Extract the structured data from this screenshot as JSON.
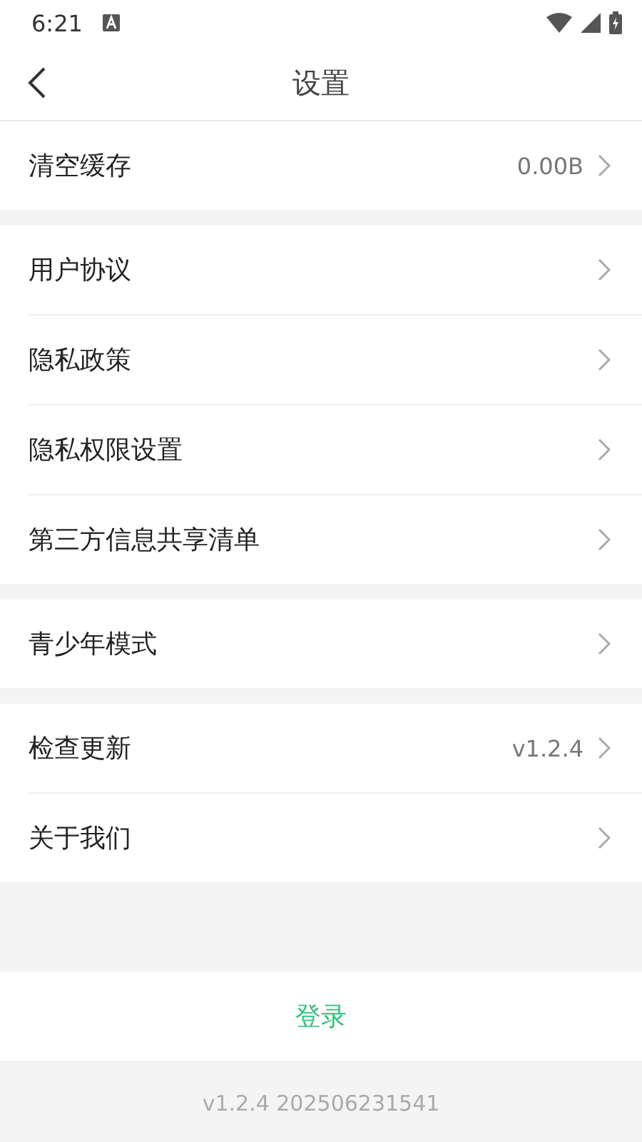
{
  "status_bar": {
    "time": "6:21"
  },
  "header": {
    "title": "设置"
  },
  "groups": [
    {
      "items": [
        {
          "label": "清空缓存",
          "value": "0.00B"
        }
      ]
    },
    {
      "items": [
        {
          "label": "用户协议"
        },
        {
          "label": "隐私政策"
        },
        {
          "label": "隐私权限设置"
        },
        {
          "label": "第三方信息共享清单"
        }
      ]
    },
    {
      "items": [
        {
          "label": "青少年模式"
        }
      ]
    },
    {
      "items": [
        {
          "label": "检查更新",
          "value": "v1.2.4"
        },
        {
          "label": "关于我们"
        }
      ]
    }
  ],
  "login_button": "登录",
  "footer": {
    "version": "v1.2.4 202506231541"
  }
}
